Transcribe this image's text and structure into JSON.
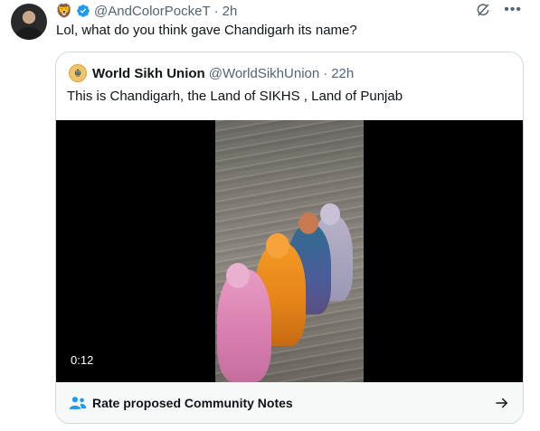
{
  "tweet": {
    "avatar_icon": "user-avatar",
    "badge_icon": "lion-emoji",
    "verified_icon": "verified-badge",
    "handle": "@AndColorPockeT",
    "separator": "·",
    "time": "2h",
    "text": "Lol, what do you think gave Chandigarh its name?",
    "grok_icon": "grok-icon",
    "more_icon": "more-icon"
  },
  "quote": {
    "avatar_icon": "khanda-logo",
    "name": "World Sikh Union",
    "handle": "@WorldSikhUnion",
    "separator": "·",
    "time": "22h",
    "text": "This is Chandigarh, the Land of SIKHS , Land of Punjab",
    "video": {
      "timecode": "0:12"
    }
  },
  "community_notes": {
    "label": "Rate proposed Community Notes",
    "icon": "people-icon",
    "arrow_icon": "arrow-right-icon"
  },
  "colors": {
    "text_primary": "#0f1419",
    "text_secondary": "#536471",
    "border": "#cfd9de",
    "accent_blue": "#1d9bf0",
    "notes_background": "#f7f9f9"
  }
}
